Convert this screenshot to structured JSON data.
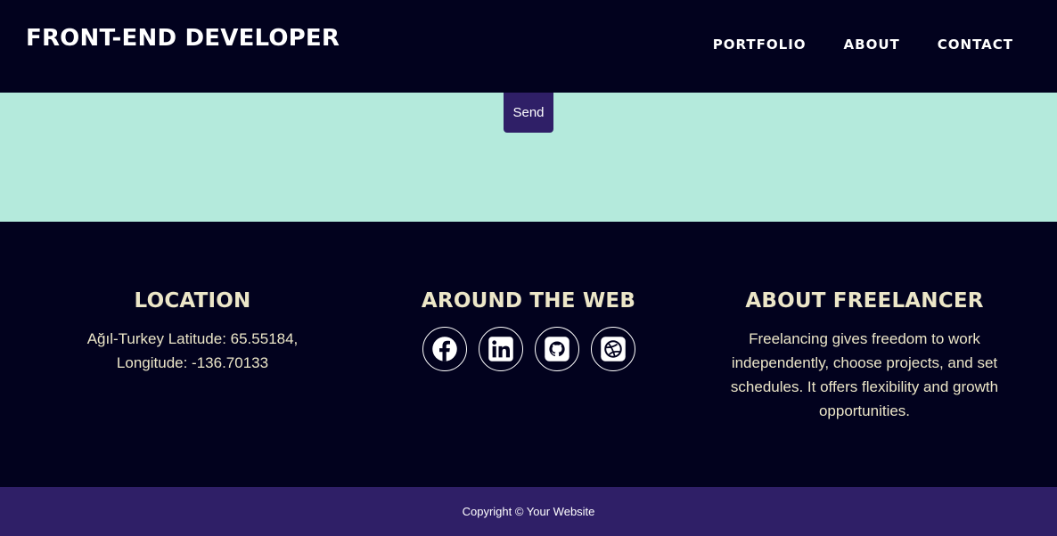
{
  "navbar": {
    "brand": "FRONT-END DEVELOPER",
    "links": [
      "PORTFOLIO",
      "ABOUT",
      "CONTACT"
    ]
  },
  "contact": {
    "send_label": "Send"
  },
  "footer": {
    "location": {
      "heading": "LOCATION",
      "text": "Ağıl-Turkey Latitude: 65.55184, Longitude: -136.70133"
    },
    "web": {
      "heading": "AROUND THE WEB",
      "icons": [
        "facebook-icon",
        "linkedin-icon",
        "github-icon",
        "dribbble-icon"
      ]
    },
    "about": {
      "heading": "ABOUT FREELANCER",
      "text": "Freelancing gives freedom to work independently, choose projects, and set schedules. It offers flexibility and growth opportunities."
    }
  },
  "copyright": "Copyright © Your Website",
  "colors": {
    "background": "#02021e",
    "contact_bg": "#b4eadc",
    "accent": "#2f1f67",
    "footer_text": "#ece6c8"
  }
}
